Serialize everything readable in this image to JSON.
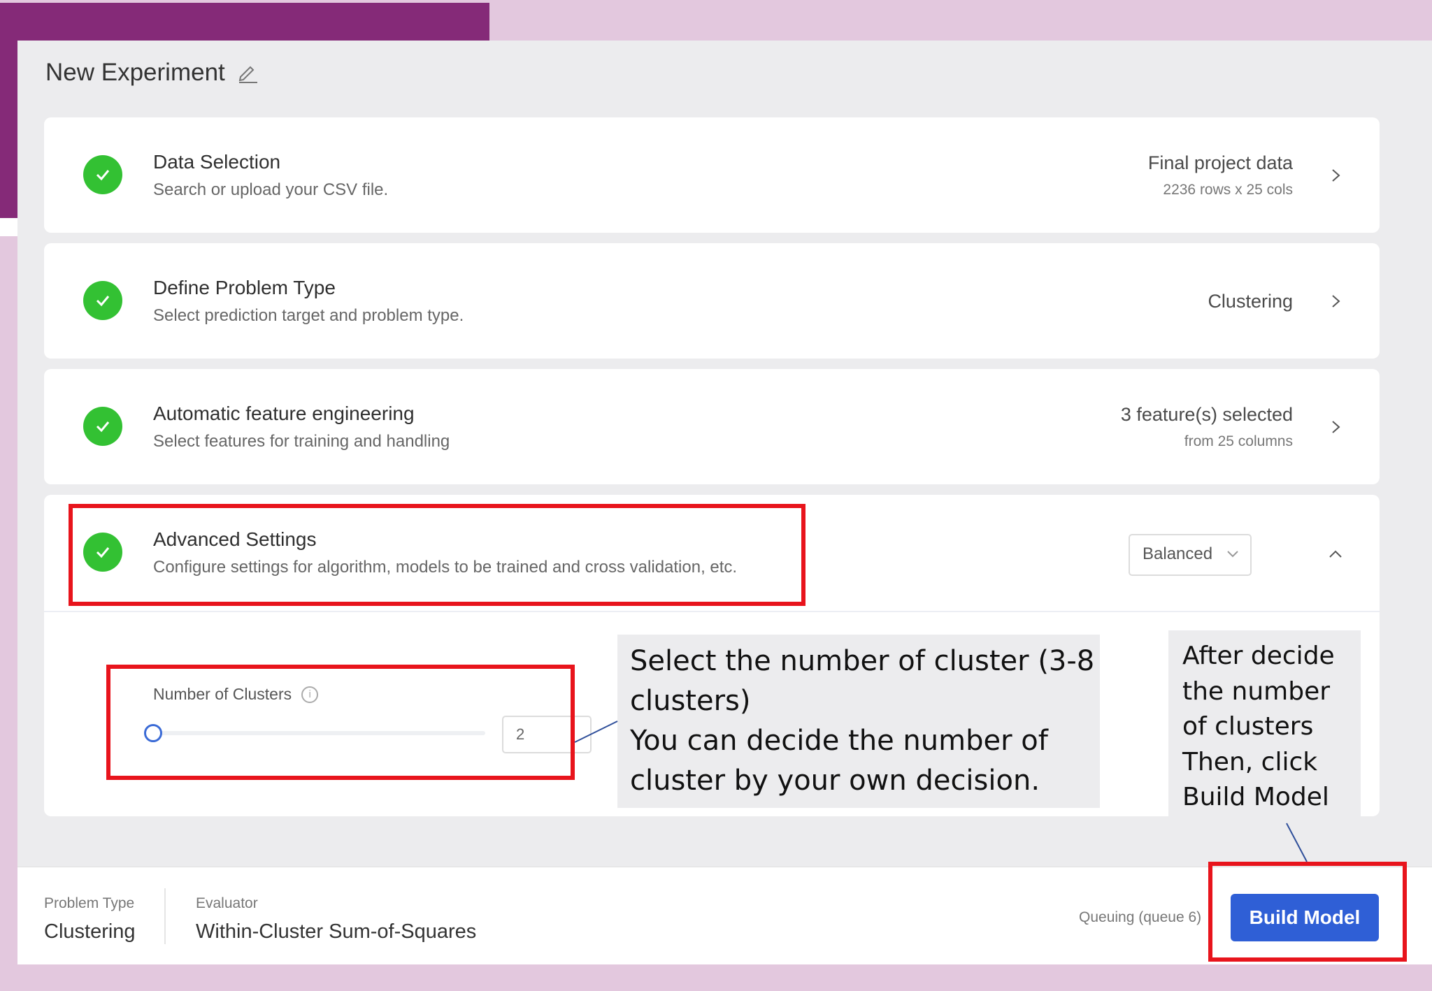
{
  "experiment": {
    "title": "New Experiment"
  },
  "steps": [
    {
      "title": "Data Selection",
      "subtitle": "Search or upload your CSV file.",
      "right_main": "Final project data",
      "right_sub": "2236 rows x 25 cols"
    },
    {
      "title": "Define Problem Type",
      "subtitle": "Select prediction target and problem type.",
      "right_main": "Clustering",
      "right_sub": ""
    },
    {
      "title": "Automatic feature engineering",
      "subtitle": "Select features for training and handling",
      "right_main": "3 feature(s) selected",
      "right_sub": "from 25 columns"
    },
    {
      "title": "Advanced Settings",
      "subtitle": "Configure settings for algorithm, models to be trained and cross validation, etc.",
      "preset": "Balanced"
    }
  ],
  "clusters": {
    "label": "Number of Clusters",
    "value": "2",
    "slider_fraction": 0
  },
  "footer": {
    "problem_type_label": "Problem Type",
    "problem_type_value": "Clustering",
    "evaluator_label": "Evaluator",
    "evaluator_value": "Within-Cluster Sum-of-Squares",
    "queue_status": "Queuing (queue 6)",
    "build_label": "Build Model"
  },
  "annotations": {
    "cluster_note": [
      "Select the number of cluster (3-8",
      "clusters)",
      "You can decide the number of",
      "cluster  by your own decision."
    ],
    "build_note": [
      "After decide",
      "the number",
      "of clusters",
      "Then, click",
      "Build Model"
    ]
  },
  "colors": {
    "accent": "#2f5fd6",
    "check": "#33c133",
    "highlight": "#e8141c",
    "brand_purple": "#852a78"
  }
}
